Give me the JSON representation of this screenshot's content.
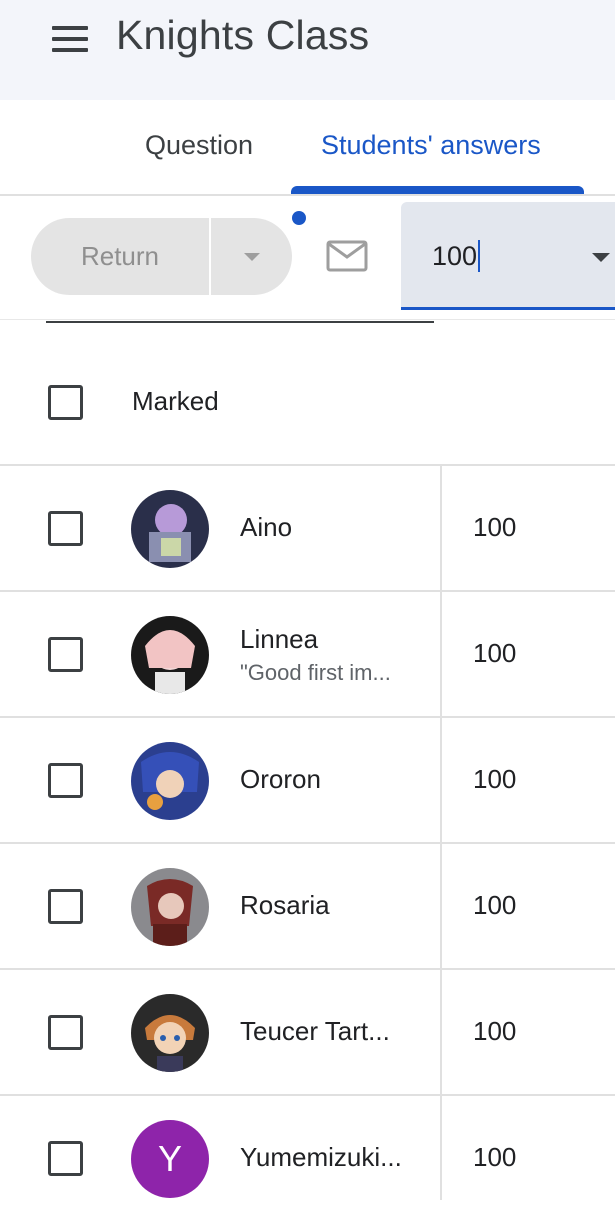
{
  "app": {
    "title": "Knights Class"
  },
  "tabs": [
    {
      "label": "Question",
      "active": false
    },
    {
      "label": "Students' answers",
      "active": true
    }
  ],
  "toolbar": {
    "return_label": "Return",
    "grade_value": "100"
  },
  "list_header": {
    "label": "Marked"
  },
  "students": [
    {
      "name": "Aino",
      "comment": "",
      "score": "100"
    },
    {
      "name": "Linnea",
      "comment": "\"Good first im...",
      "score": "100"
    },
    {
      "name": "Ororon",
      "comment": "",
      "score": "100"
    },
    {
      "name": "Rosaria",
      "comment": "",
      "score": "100"
    },
    {
      "name": "Teucer Tart...",
      "comment": "",
      "score": "100"
    },
    {
      "name": "Yumemizuki...",
      "comment": "",
      "score": "100",
      "avatar_letter": "Y"
    }
  ],
  "colors": {
    "accent": "#1a57c7",
    "appbar_bg": "#f3f5fa",
    "avatar_letter_bg": "#8e24aa"
  }
}
